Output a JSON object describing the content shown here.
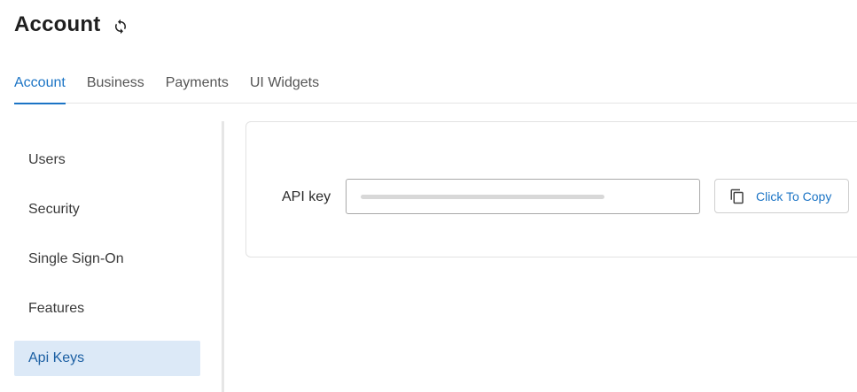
{
  "header": {
    "title": "Account",
    "refresh_icon": "refresh-icon"
  },
  "tabs": [
    {
      "label": "Account",
      "active": true
    },
    {
      "label": "Business",
      "active": false
    },
    {
      "label": "Payments",
      "active": false
    },
    {
      "label": "UI Widgets",
      "active": false
    }
  ],
  "sidebar": {
    "items": [
      {
        "label": "Users"
      },
      {
        "label": "Security"
      },
      {
        "label": "Single Sign-On"
      },
      {
        "label": "Features"
      },
      {
        "label": "Api Keys",
        "active": true
      }
    ]
  },
  "api_key_card": {
    "label": "API key",
    "copy_button_label": "Click To Copy",
    "copy_icon": "copy-icon"
  },
  "colors": {
    "accent": "#1b74c5",
    "active_sidebar_bg": "#dce9f7"
  }
}
